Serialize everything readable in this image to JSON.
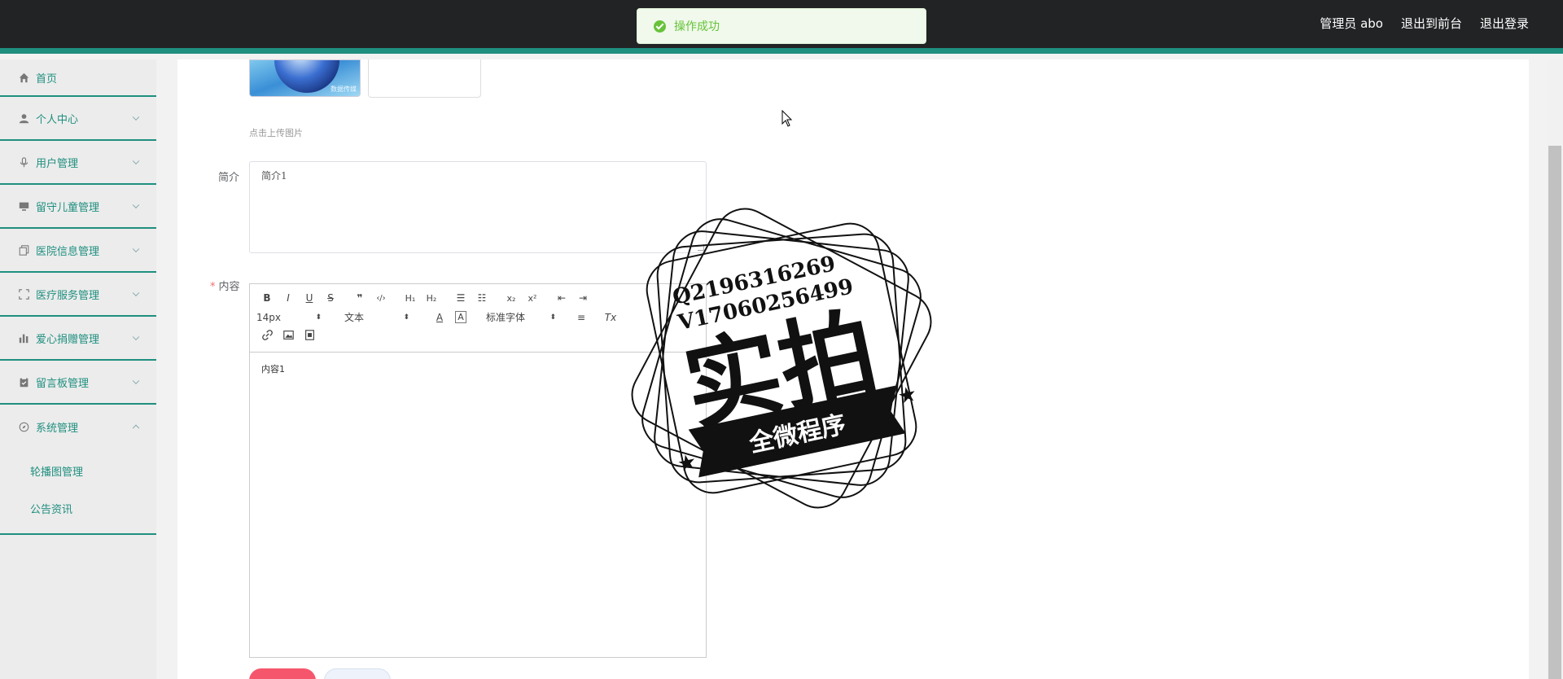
{
  "header": {
    "admin_label": "管理员 abo",
    "to_frontend": "退出到前台",
    "logout": "退出登录"
  },
  "toast": {
    "message": "操作成功"
  },
  "sidebar": {
    "items": [
      {
        "label": "首页",
        "icon": "home-icon"
      },
      {
        "label": "个人中心",
        "icon": "user-icon"
      },
      {
        "label": "用户管理",
        "icon": "microphone-icon"
      },
      {
        "label": "留守儿童管理",
        "icon": "monitor-icon"
      },
      {
        "label": "医院信息管理",
        "icon": "copy-icon"
      },
      {
        "label": "医疗服务管理",
        "icon": "fullscreen-icon"
      },
      {
        "label": "爱心捐赠管理",
        "icon": "bar-chart-icon"
      },
      {
        "label": "留言板管理",
        "icon": "clipboard-icon"
      },
      {
        "label": "系统管理",
        "icon": "compass-icon"
      }
    ],
    "subitems": [
      {
        "label": "轮播图管理"
      },
      {
        "label": "公告资讯"
      }
    ]
  },
  "form": {
    "upload_hint": "点击上传图片",
    "thumb_caption": "数据传媒",
    "intro_label": "简介",
    "intro_value": "简介1",
    "content_label": "内容",
    "content_value": "内容1",
    "toolbar": {
      "font_size": "14px",
      "header_select": "文本",
      "font_family": "标准字体"
    }
  },
  "watermark": {
    "line1": "Q2196316269",
    "line2": "V17060256499",
    "main": "实拍",
    "banner": "全微程序"
  },
  "colors": {
    "accent": "#1f8f7f",
    "header_bg": "#222325",
    "success": "#67c23a",
    "danger": "#f5566c"
  }
}
